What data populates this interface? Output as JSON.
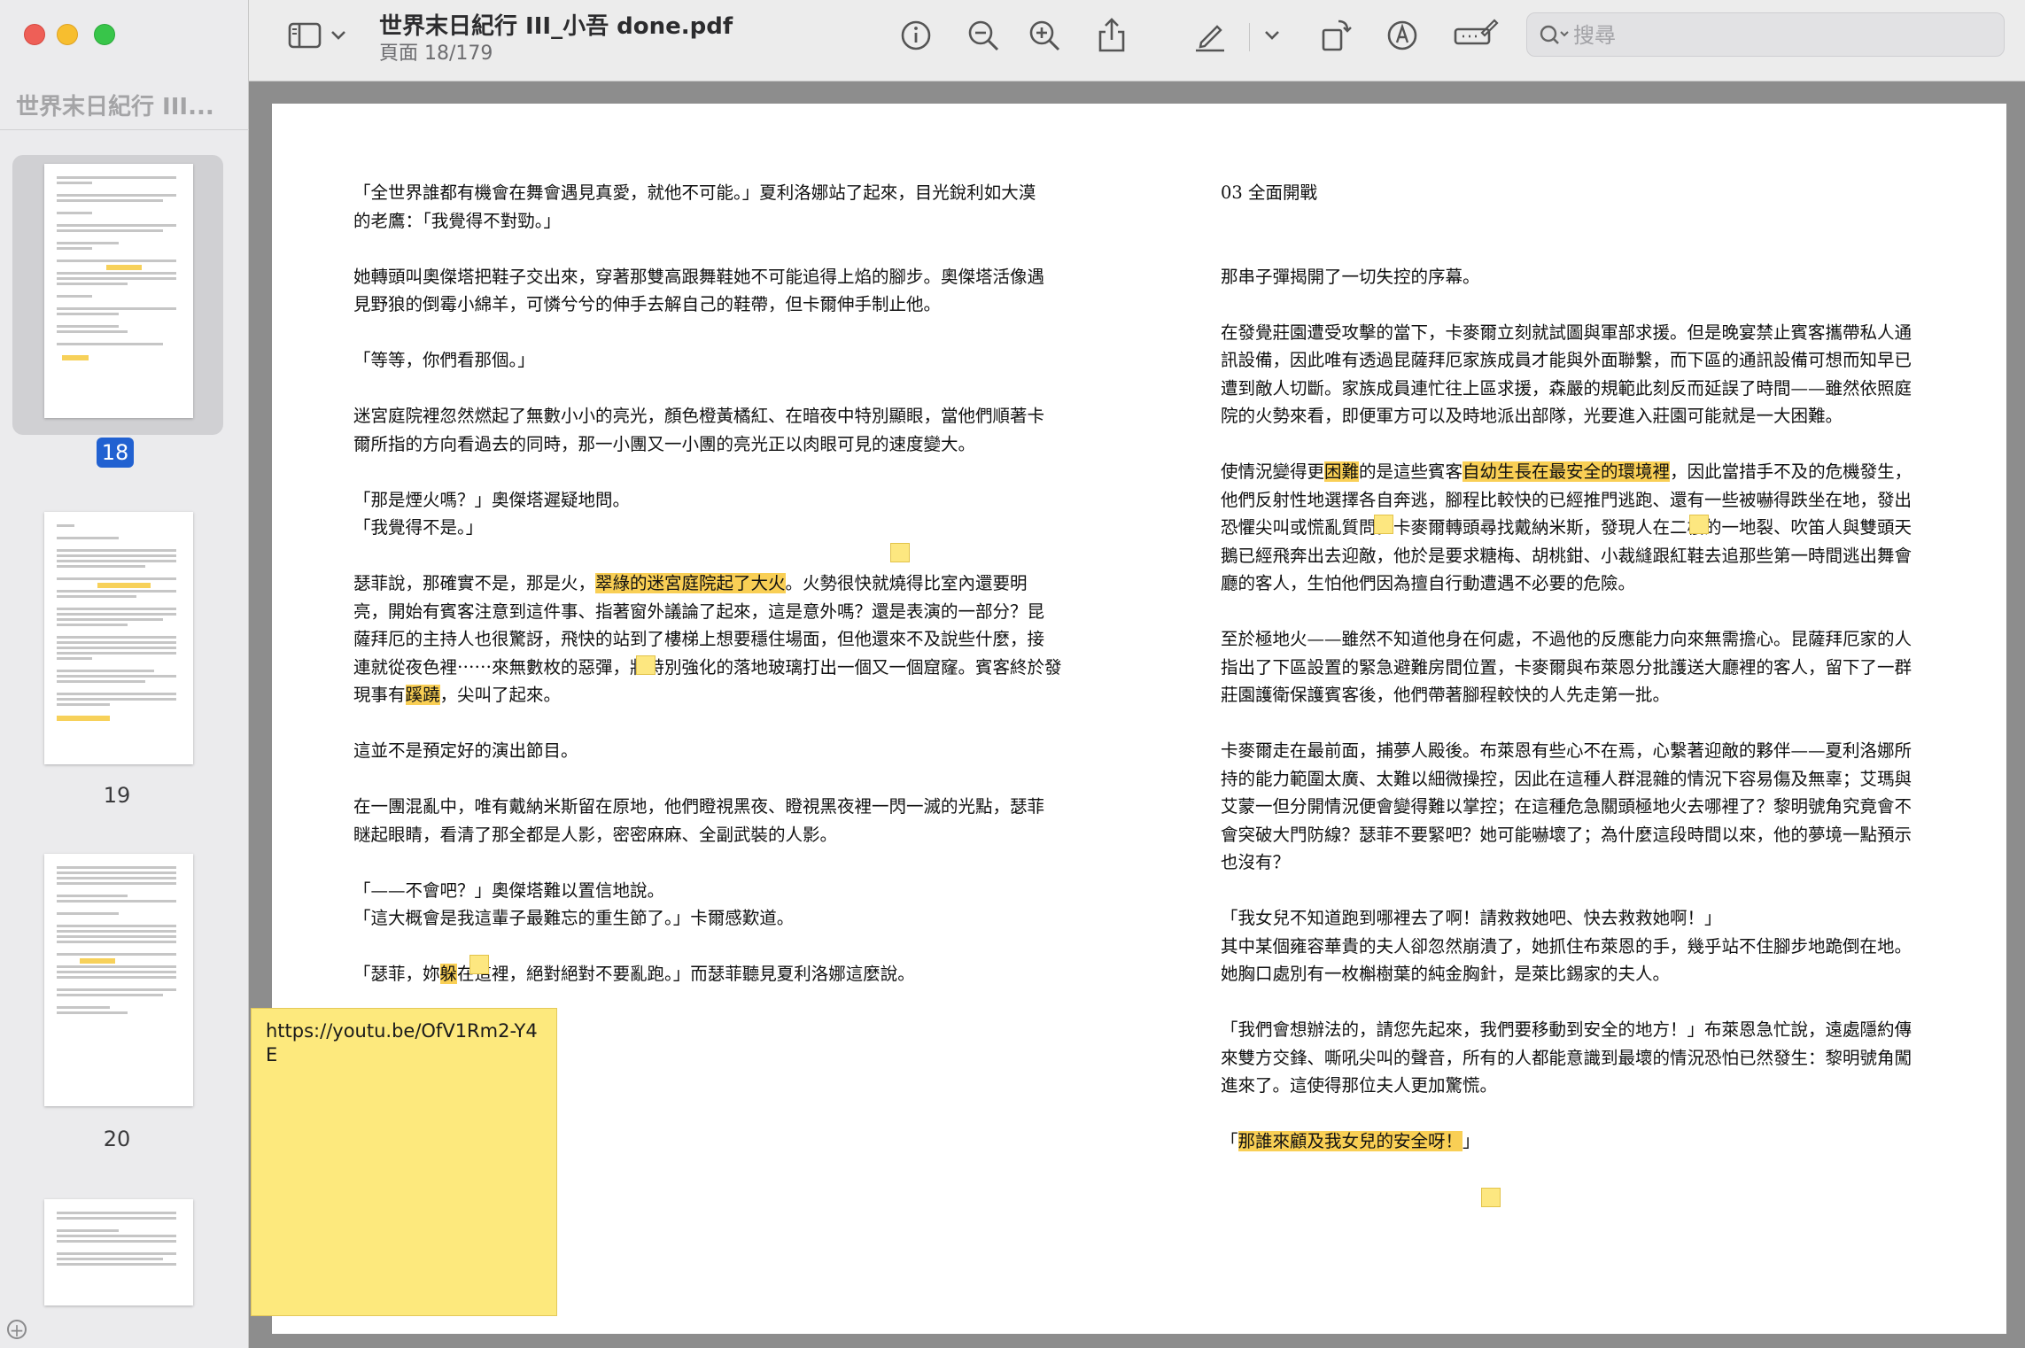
{
  "window": {
    "title": "世界末日紀行 III_小吾 done.pdf",
    "page_info": "頁面 18/179"
  },
  "sidebar": {
    "title": "世界末日紀行 III...",
    "pages": [
      "18",
      "19",
      "20"
    ]
  },
  "search": {
    "placeholder": "搜尋"
  },
  "sticky_note": {
    "text": "https://youtu.be/OfV1Rm2-Y4E"
  },
  "left_column": [
    [
      {
        "t": "「全世界誰都有機會在舞會遇見真愛，就他不可能。」夏利洛娜站了起來，目光銳利如大漠"
      },
      {
        "br": 1
      },
      {
        "t": "的老鷹：「我覺得不對勁。」"
      }
    ],
    [
      {
        "t": "她轉頭叫奧傑塔把鞋子交出來，穿著那雙高跟舞鞋她不可能追得上焰的腳步。奧傑塔活像遇"
      },
      {
        "br": 1
      },
      {
        "t": "見野狼的倒霉小綿羊，可憐兮兮的伸手去解自己的鞋帶，但卡爾伸手制止他。"
      }
    ],
    [
      {
        "t": "「等等，你們看那個。」"
      }
    ],
    [
      {
        "t": "迷宮庭院裡忽然燃起了無數小小的亮光，顏色橙黃橘紅、在暗夜中特別顯眼，當他們順著卡"
      },
      {
        "br": 1
      },
      {
        "t": "爾所指的方向看過去的同時，那一小團又一小團的亮光正以肉眼可見的速度變大。"
      }
    ],
    [
      {
        "t": "「那是煙火嗎？」奧傑塔遲疑地問。"
      },
      {
        "br": 1
      },
      {
        "t": "「我覺得不是。」"
      }
    ],
    [
      {
        "t": "瑟菲說，那確實不是，那是火，"
      },
      {
        "t": "翠綠的迷宮庭院起了大火",
        "h": 1
      },
      {
        "t": "。火勢很快就燒得比室內還要明"
      },
      {
        "br": 1
      },
      {
        "t": "亮，開始有賓客注意到這件事、指著窗外議論了起來，這是意外嗎？還是表演的一部分？昆"
      },
      {
        "br": 1
      },
      {
        "t": "薩拜厄的主持人也很驚訝，飛快的站到了樓梯上想要穩住場面，但他還來不及說些什麼，接"
      },
      {
        "br": 1
      },
      {
        "t": "連就從夜色裡⋯⋯來無數枚的惡彈，將特別強化的落地玻璃打出一個又一個窟窿。賓客終於發"
      },
      {
        "br": 1
      },
      {
        "t": "現事有"
      },
      {
        "t": "蹊蹺",
        "h": 1
      },
      {
        "t": "，尖叫了起來。"
      }
    ],
    [
      {
        "t": "這並不是預定好的演出節目。"
      }
    ],
    [
      {
        "t": "在一團混亂中，唯有戴納米斯留在原地，他們瞪視黑夜、瞪視黑夜裡一閃一滅的光點，瑟菲"
      },
      {
        "br": 1
      },
      {
        "t": "瞇起眼睛，看清了那全都是人影，密密麻麻、全副武裝的人影。"
      }
    ],
    [
      {
        "t": "「——不會吧？」奧傑塔難以置信地說。"
      },
      {
        "br": 1
      },
      {
        "t": "「這大概會是我這輩子最難忘的重生節了。」卡爾感歎道。"
      }
    ],
    [
      {
        "t": "「瑟菲，妳"
      },
      {
        "t": "躲",
        "h": 1
      },
      {
        "t": "在這裡，絕對絕對不要亂跑。」而瑟菲聽見夏利洛娜這麼說。"
      }
    ]
  ],
  "right_column": [
    [
      {
        "t": "03 全面開戰"
      }
    ],
    [
      {
        "t": " "
      }
    ],
    [
      {
        "t": "那串子彈揭開了一切失控的序幕。"
      }
    ],
    [
      {
        "t": "在發覺莊園遭受攻擊的當下，卡麥爾立刻就試圖與軍部求援。但是晚宴禁止賓客攜帶私人通"
      },
      {
        "br": 1
      },
      {
        "t": "訊設備，因此唯有透過昆薩拜厄家族成員才能與外面聯繫，而下區的通訊設備可想而知早已"
      },
      {
        "br": 1
      },
      {
        "t": "遭到敵人切斷。家族成員連忙往上區求援，森嚴的規範此刻反而延誤了時間——雖然依照庭"
      },
      {
        "br": 1
      },
      {
        "t": "院的火勢來看，即便軍方可以及時地派出部隊，光要進入莊園可能就是一大困難。"
      }
    ],
    [
      {
        "t": "使情況變得更"
      },
      {
        "t": "困難",
        "h": 1
      },
      {
        "t": "的是這些賓客"
      },
      {
        "t": "自幼生長在最安全的環境裡",
        "h": 1
      },
      {
        "t": "，因此當措手不及的危機發生，"
      },
      {
        "br": 1
      },
      {
        "t": "他們反射性地選擇各自奔逃，腳程比較快的已經推門逃跑、還有一些被嚇得跌坐在地，發出"
      },
      {
        "br": 1
      },
      {
        "t": "恐懼尖叫或慌亂質問。卡麥爾轉頭尋找戴納米斯，發現人在二樓的一地裂、吹笛人與雙頭天"
      },
      {
        "br": 1
      },
      {
        "t": "鵝已經飛奔出去迎敵，他於是要求糖梅、胡桃鉗、小裁縫跟紅鞋去追那些第一時間逃出舞會"
      },
      {
        "br": 1
      },
      {
        "t": "廳的客人，生怕他們因為擅自行動遭遇不必要的危險。"
      }
    ],
    [
      {
        "t": "至於極地火——雖然不知道他身在何處，不過他的反應能力向來無需擔心。昆薩拜厄家的人"
      },
      {
        "br": 1
      },
      {
        "t": "指出了下區設置的緊急避難房間位置，卡麥爾與布萊恩分批護送大廳裡的客人，留下了一群"
      },
      {
        "br": 1
      },
      {
        "t": "莊園護衛保護賓客後，他們帶著腳程較快的人先走第一批。"
      }
    ],
    [
      {
        "t": "卡麥爾走在最前面，捕夢人殿後。布萊恩有些心不在焉，心繫著迎敵的夥伴——夏利洛娜所"
      },
      {
        "br": 1
      },
      {
        "t": "持的能力範圍太廣、太難以細微操控，因此在這種人群混雜的情況下容易傷及無辜；艾瑪與"
      },
      {
        "br": 1
      },
      {
        "t": "艾蒙一但分開情況便會變得難以掌控；在這種危急關頭極地火去哪裡了？黎明號角究竟會不"
      },
      {
        "br": 1
      },
      {
        "t": "會突破大門防線？瑟菲不要緊吧？她可能嚇壞了；為什麼這段時間以來，他的夢境一點預示"
      },
      {
        "br": 1
      },
      {
        "t": "也沒有？"
      }
    ],
    [
      {
        "t": "「我女兒不知道跑到哪裡去了啊！請救救她吧、快去救救她啊！」"
      },
      {
        "br": 1
      },
      {
        "t": "其中某個雍容華貴的夫人卻忽然崩潰了，她抓住布萊恩的手，幾乎站不住腳步地跪倒在地。"
      },
      {
        "br": 1
      },
      {
        "t": "她胸口處別有一枚槲樹葉的純金胸針，是萊比錫家的夫人。"
      }
    ],
    [
      {
        "t": "「我們會想辦法的，請您先起來，我們要移動到安全的地方！」布萊恩急忙說，遠處隱約傳"
      },
      {
        "br": 1
      },
      {
        "t": "來雙方交鋒、嘶吼尖叫的聲音，所有的人都能意識到最壞的情況恐怕已然發生：黎明號角闖"
      },
      {
        "br": 1
      },
      {
        "t": "進來了。這使得那位夫人更加驚慌。"
      }
    ],
    [
      {
        "t": "「"
      },
      {
        "t": "那誰來顧及我女兒的安全呀！",
        "h": 1
      },
      {
        "t": "」"
      }
    ]
  ]
}
